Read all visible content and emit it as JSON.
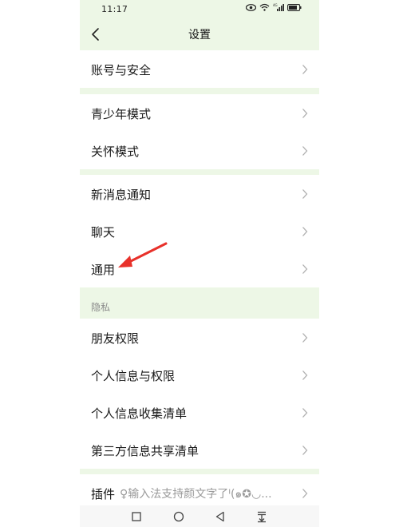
{
  "status_bar": {
    "time": "11:17"
  },
  "header": {
    "title": "设置"
  },
  "rows": [
    {
      "label": "账号与安全"
    },
    {
      "label": "青少年模式"
    },
    {
      "label": "关怀模式"
    },
    {
      "label": "新消息通知"
    },
    {
      "label": "聊天"
    },
    {
      "label": "通用"
    },
    {
      "label": "朋友权限"
    },
    {
      "label": "个人信息与权限"
    },
    {
      "label": "个人信息收集清单"
    },
    {
      "label": "第三方信息共享清单"
    }
  ],
  "privacy_section": {
    "label": "隐私"
  },
  "plugin_row": {
    "label": "插件",
    "hint": "♀输入法支持颜文字了ᑊ(๑✪◡..."
  },
  "colors": {
    "accent_arrow": "#e8312a",
    "page_bg": "#edf7e6",
    "row_bg": "#ffffff"
  },
  "icons": {
    "back": "chevron-left-icon",
    "row_chevron": "chevron-right-icon",
    "nav_home": "square-icon",
    "nav_circle": "circle-icon",
    "nav_back": "triangle-left-icon",
    "nav_menu": "down-arrow-menu-icon"
  }
}
